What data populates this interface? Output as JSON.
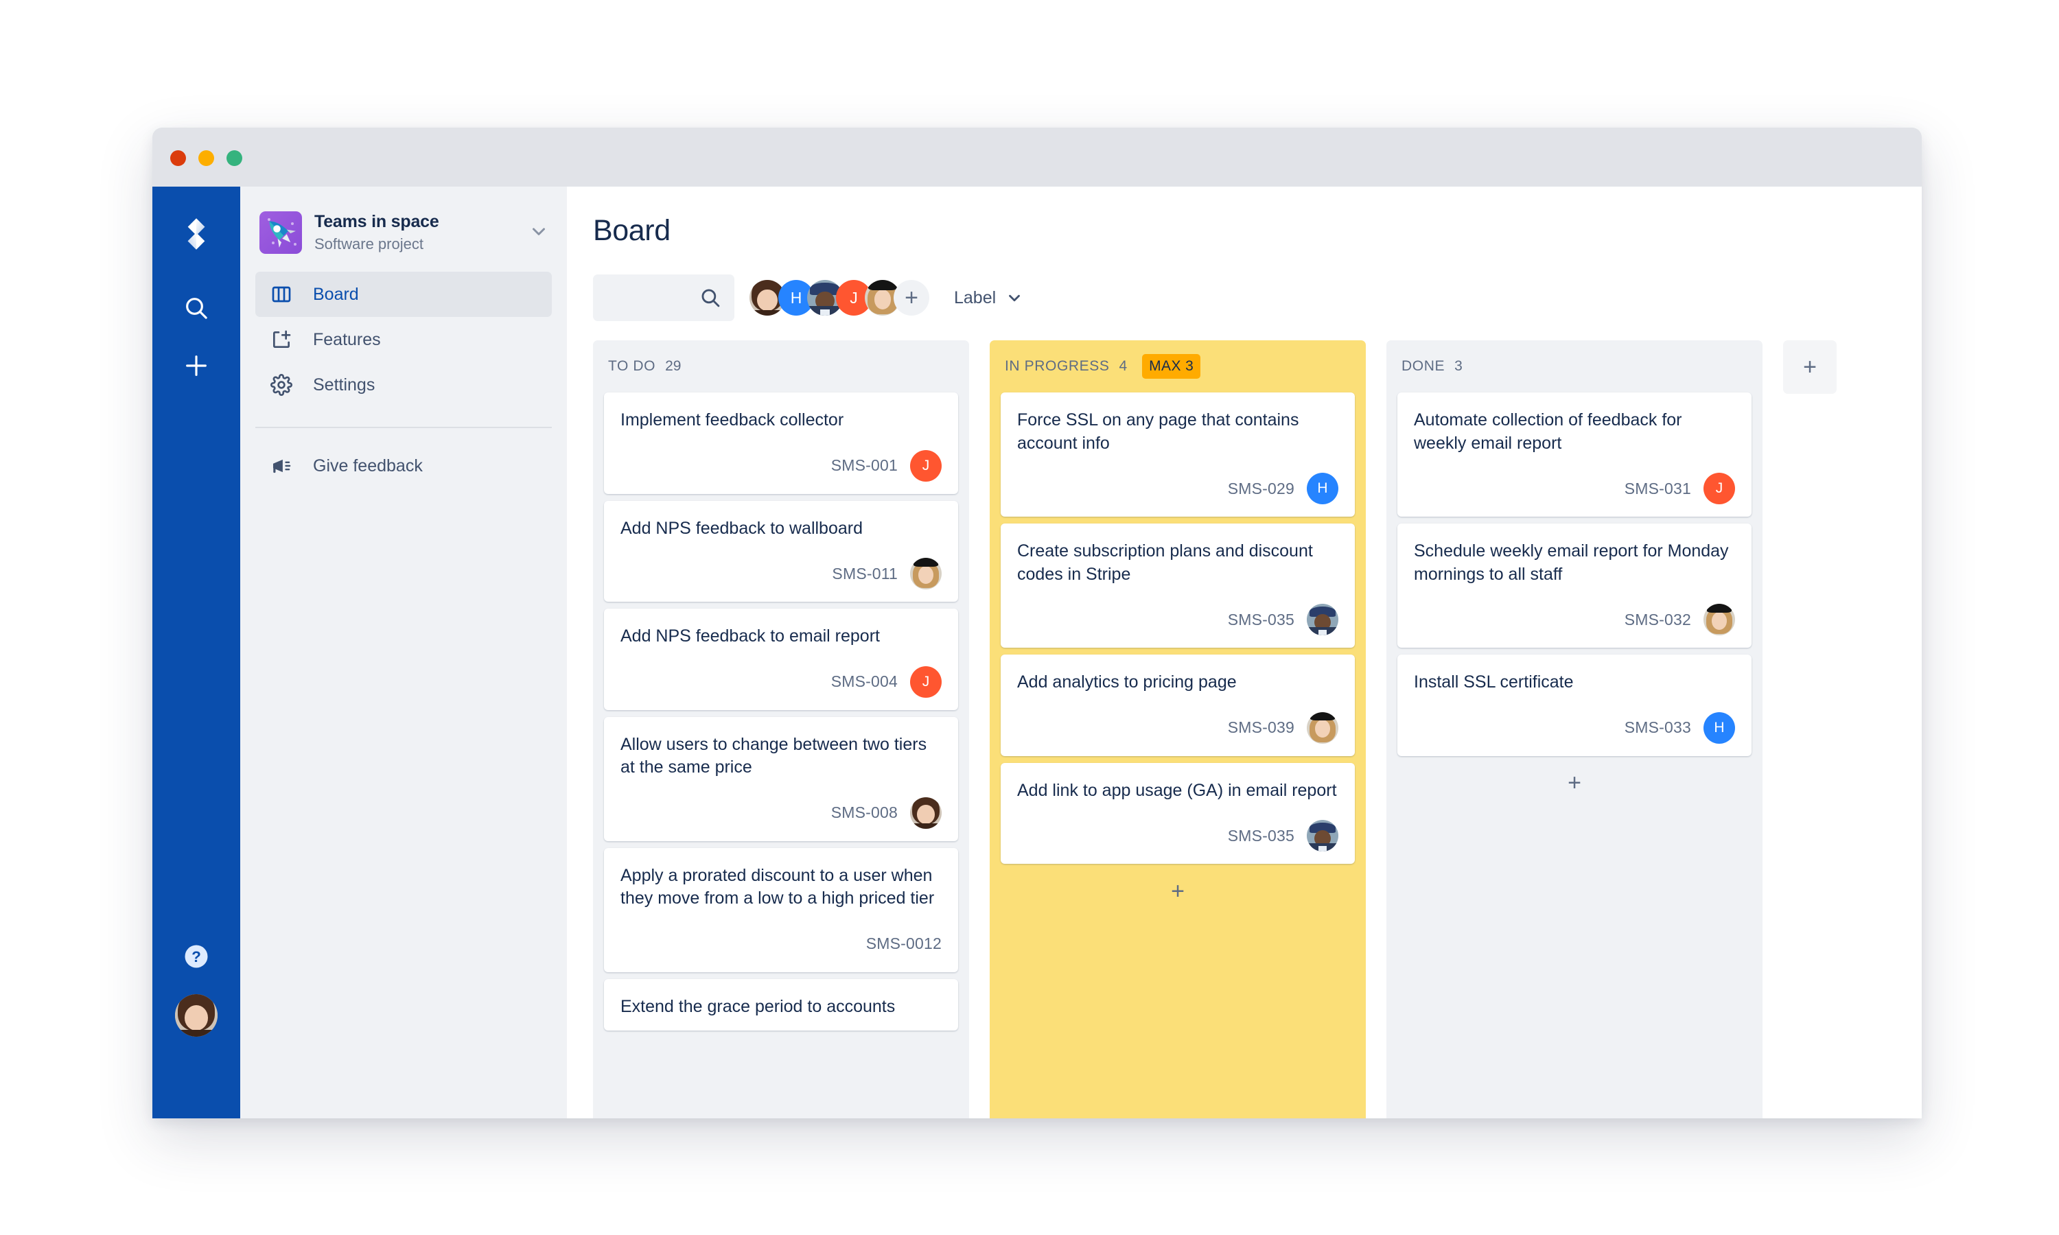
{
  "window": {
    "traffic_lights": [
      "close",
      "minimize",
      "zoom"
    ]
  },
  "global_rail": {
    "logo_icon": "jira-logo-icon",
    "items": [
      {
        "icon": "search-icon",
        "name": "search"
      },
      {
        "icon": "plus-icon",
        "name": "create"
      }
    ],
    "help_icon": "help-circle-icon",
    "avatar": {
      "name": "current-user-avatar",
      "kind": "photo",
      "photo": "ph-ali"
    }
  },
  "sidebar": {
    "project": {
      "name": "Teams in space",
      "type": "Software project",
      "avatar_icon": "rocket-icon",
      "chevron_icon": "chevron-down-icon"
    },
    "items": [
      {
        "label": "Board",
        "icon": "board-columns-icon",
        "active": true
      },
      {
        "label": "Features",
        "icon": "add-page-icon",
        "active": false
      },
      {
        "label": "Settings",
        "icon": "gear-icon",
        "active": false
      }
    ],
    "feedback": {
      "label": "Give feedback",
      "icon": "megaphone-icon"
    }
  },
  "main": {
    "title": "Board",
    "search": {
      "value": "",
      "placeholder": "",
      "icon": "search-icon"
    },
    "avatar_stack": [
      {
        "name": "avatar-alana",
        "kind": "photo",
        "photo": "ph-ali"
      },
      {
        "name": "avatar-h",
        "kind": "initial",
        "initial": "H",
        "color": "#2684ff"
      },
      {
        "name": "avatar-ryan",
        "kind": "photo",
        "photo": "ph-ryan"
      },
      {
        "name": "avatar-j",
        "kind": "initial",
        "initial": "J",
        "color": "#ff5630"
      },
      {
        "name": "avatar-emma",
        "kind": "photo",
        "photo": "ph-emma"
      }
    ],
    "add_people_label": "+",
    "label_filter": {
      "label": "Label",
      "chevron_icon": "chevron-down-icon"
    },
    "add_column_label": "+"
  },
  "board": {
    "columns": [
      {
        "id": "todo",
        "title": "TO DO",
        "count": "29",
        "max": null,
        "wip_exceeded": false,
        "add_card_label": "+",
        "show_add_card": false,
        "cards": [
          {
            "title": "Implement feedback collector",
            "key": "SMS-001",
            "assignee": {
              "kind": "initial",
              "initial": "J",
              "color": "#ff5630"
            }
          },
          {
            "title": "Add NPS feedback to wallboard",
            "key": "SMS-011",
            "assignee": {
              "kind": "photo",
              "photo": "ph-emma"
            }
          },
          {
            "title": "Add NPS feedback to email report",
            "key": "SMS-004",
            "assignee": {
              "kind": "initial",
              "initial": "J",
              "color": "#ff5630"
            }
          },
          {
            "title": "Allow users to change between two tiers at the same price",
            "key": "SMS-008",
            "assignee": {
              "kind": "photo",
              "photo": "ph-ali"
            }
          },
          {
            "title": "Apply a prorated discount to a user when they move from a low to a high priced tier",
            "key": "SMS-0012",
            "assignee": null
          },
          {
            "title": "Extend the grace period to accounts",
            "key": "",
            "assignee": null
          }
        ]
      },
      {
        "id": "inprogress",
        "title": "IN PROGRESS",
        "count": "4",
        "max": "MAX 3",
        "wip_exceeded": true,
        "add_card_label": "+",
        "show_add_card": true,
        "cards": [
          {
            "title": "Force SSL on any page that contains account info",
            "key": "SMS-029",
            "assignee": {
              "kind": "initial",
              "initial": "H",
              "color": "#2684ff"
            }
          },
          {
            "title": "Create subscription plans and discount codes in Stripe",
            "key": "SMS-035",
            "assignee": {
              "kind": "photo",
              "photo": "ph-ryan"
            }
          },
          {
            "title": "Add analytics to pricing page",
            "key": "SMS-039",
            "assignee": {
              "kind": "photo",
              "photo": "ph-emma"
            }
          },
          {
            "title": "Add link to app usage (GA) in email report",
            "key": "SMS-035",
            "assignee": {
              "kind": "photo",
              "photo": "ph-ryan"
            }
          }
        ]
      },
      {
        "id": "done",
        "title": "DONE",
        "count": "3",
        "max": null,
        "wip_exceeded": false,
        "add_card_label": "+",
        "show_add_card": true,
        "cards": [
          {
            "title": "Automate collection of feedback for weekly email report",
            "key": "SMS-031",
            "assignee": {
              "kind": "initial",
              "initial": "J",
              "color": "#ff5630"
            }
          },
          {
            "title": "Schedule weekly email report for Monday mornings to all staff",
            "key": "SMS-032",
            "assignee": {
              "kind": "photo",
              "photo": "ph-emma"
            }
          },
          {
            "title": "Install SSL certificate",
            "key": "SMS-033",
            "assignee": {
              "kind": "initial",
              "initial": "H",
              "color": "#2684ff"
            }
          }
        ]
      }
    ]
  },
  "colors": {
    "brand_blue": "#0a4ead",
    "wip_yellow": "#fbdf78",
    "max_badge": "#ffab00",
    "text_primary": "#172b4d",
    "text_subtle": "#5e6c84",
    "surface_grey": "#f0f2f5"
  }
}
